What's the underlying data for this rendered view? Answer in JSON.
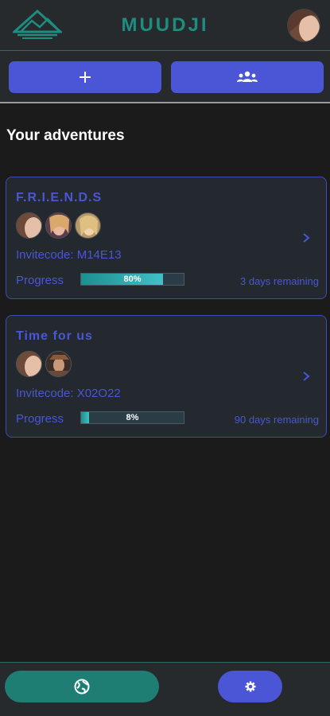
{
  "header": {
    "app_title": "MUUDJI",
    "logo_icon": "mountain-logo-icon",
    "accent_color": "#1f8c80"
  },
  "actions": {
    "add_icon": "plus-icon",
    "groups_icon": "users-icon",
    "button_color": "#4a56d6"
  },
  "section_title": "Your adventures",
  "adventures": [
    {
      "title": "F.R.I.E.N.D.S",
      "invite_label": "Invitecode: M14E13",
      "progress_label": "Progress",
      "progress_value": 80,
      "progress_text": "80%",
      "remaining": "3 days remaining",
      "member_count": 3
    },
    {
      "title": "Time for us",
      "invite_label": "Invitecode: X02O22",
      "progress_label": "Progress",
      "progress_value": 8,
      "progress_text": "8%",
      "remaining": "90 days remaining",
      "member_count": 2
    }
  ],
  "bottom_nav": {
    "globe_icon": "globe-icon",
    "settings_icon": "gear-icon"
  }
}
